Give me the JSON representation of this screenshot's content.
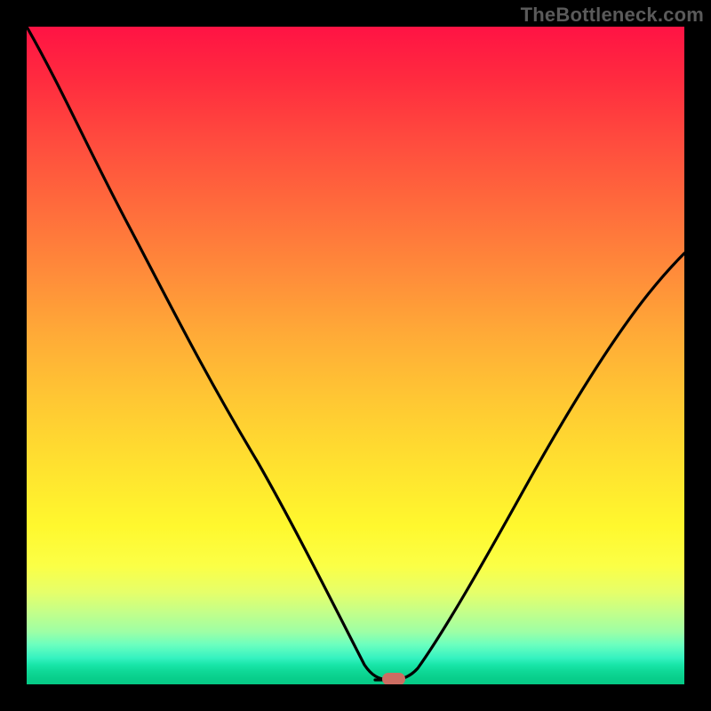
{
  "attribution": "TheBottleneck.com",
  "chart_data": {
    "type": "line",
    "title": "",
    "xlabel": "",
    "ylabel": "",
    "xlim": [
      0,
      100
    ],
    "ylim": [
      0,
      100
    ],
    "grid": false,
    "legend": false,
    "series": [
      {
        "name": "curve",
        "x": [
          0,
          3,
          7,
          12,
          17,
          22,
          27,
          32,
          36,
          40,
          44,
          47,
          50,
          52,
          54,
          57,
          60,
          63,
          67,
          71,
          76,
          81,
          86,
          91,
          96,
          100
        ],
        "y": [
          100,
          93,
          84,
          75,
          67,
          59,
          51,
          43,
          36,
          29,
          22,
          15,
          8,
          3,
          0,
          0,
          2,
          7,
          14,
          22,
          31,
          40,
          48,
          55,
          61,
          65
        ]
      }
    ],
    "marker": {
      "x": 55.5,
      "y": 0.5,
      "color": "#cc6d62"
    },
    "gradient_stops": [
      {
        "pos": 0,
        "color": "#ff1344"
      },
      {
        "pos": 50,
        "color": "#ffb936"
      },
      {
        "pos": 80,
        "color": "#fff82e"
      },
      {
        "pos": 100,
        "color": "#05c985"
      }
    ]
  }
}
